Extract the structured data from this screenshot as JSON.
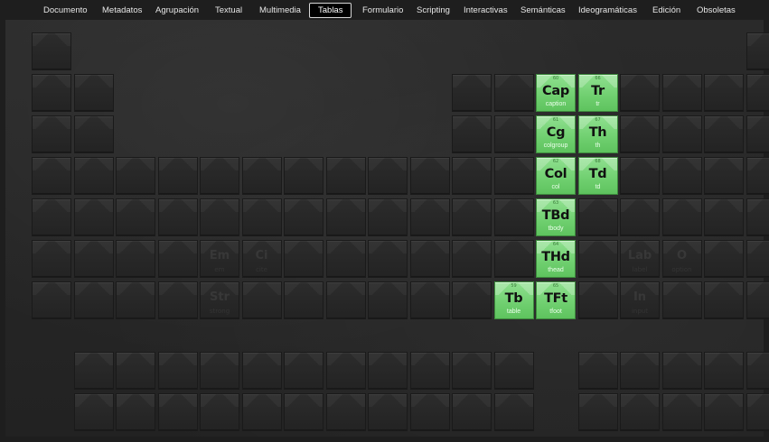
{
  "nav": {
    "items": [
      {
        "label": "Documento",
        "active": false
      },
      {
        "label": "Metadatos",
        "active": false
      },
      {
        "label": "Agrupación",
        "active": false
      },
      {
        "label": "Textual",
        "active": false
      },
      {
        "label": "Multimedia",
        "active": false
      },
      {
        "label": "Tablas",
        "active": true
      },
      {
        "label": "Formulario",
        "active": false
      },
      {
        "label": "Scripting",
        "active": false
      },
      {
        "label": "Interactivas",
        "active": false
      },
      {
        "label": "Semánticas",
        "active": false
      },
      {
        "label": "Ideogramáticas",
        "active": false
      },
      {
        "label": "Edición",
        "active": false
      },
      {
        "label": "Obsoletas",
        "active": false
      }
    ]
  },
  "elements": [
    {
      "key": "cap",
      "num": "60",
      "sym": "Cap",
      "name": "caption"
    },
    {
      "key": "tr",
      "num": "66",
      "sym": "Tr",
      "name": "tr"
    },
    {
      "key": "cg",
      "num": "61",
      "sym": "Cg",
      "name": "colgroup"
    },
    {
      "key": "th",
      "num": "67",
      "sym": "Th",
      "name": "th"
    },
    {
      "key": "col",
      "num": "62",
      "sym": "Col",
      "name": "col"
    },
    {
      "key": "td",
      "num": "68",
      "sym": "Td",
      "name": "td"
    },
    {
      "key": "tbd",
      "num": "63",
      "sym": "TBd",
      "name": "tbody"
    },
    {
      "key": "thd",
      "num": "64",
      "sym": "THd",
      "name": "thead"
    },
    {
      "key": "tb",
      "num": "59",
      "sym": "Tb",
      "name": "table"
    },
    {
      "key": "tft",
      "num": "65",
      "sym": "TFt",
      "name": "tfoot"
    }
  ],
  "ghosts": [
    {
      "sym": "Em",
      "name": "em"
    },
    {
      "sym": "Ci",
      "name": "cite"
    },
    {
      "sym": "Lab",
      "name": "label"
    },
    {
      "sym": "O",
      "name": "option"
    },
    {
      "sym": "Str",
      "name": "strong"
    },
    {
      "sym": "In",
      "name": "input"
    }
  ]
}
